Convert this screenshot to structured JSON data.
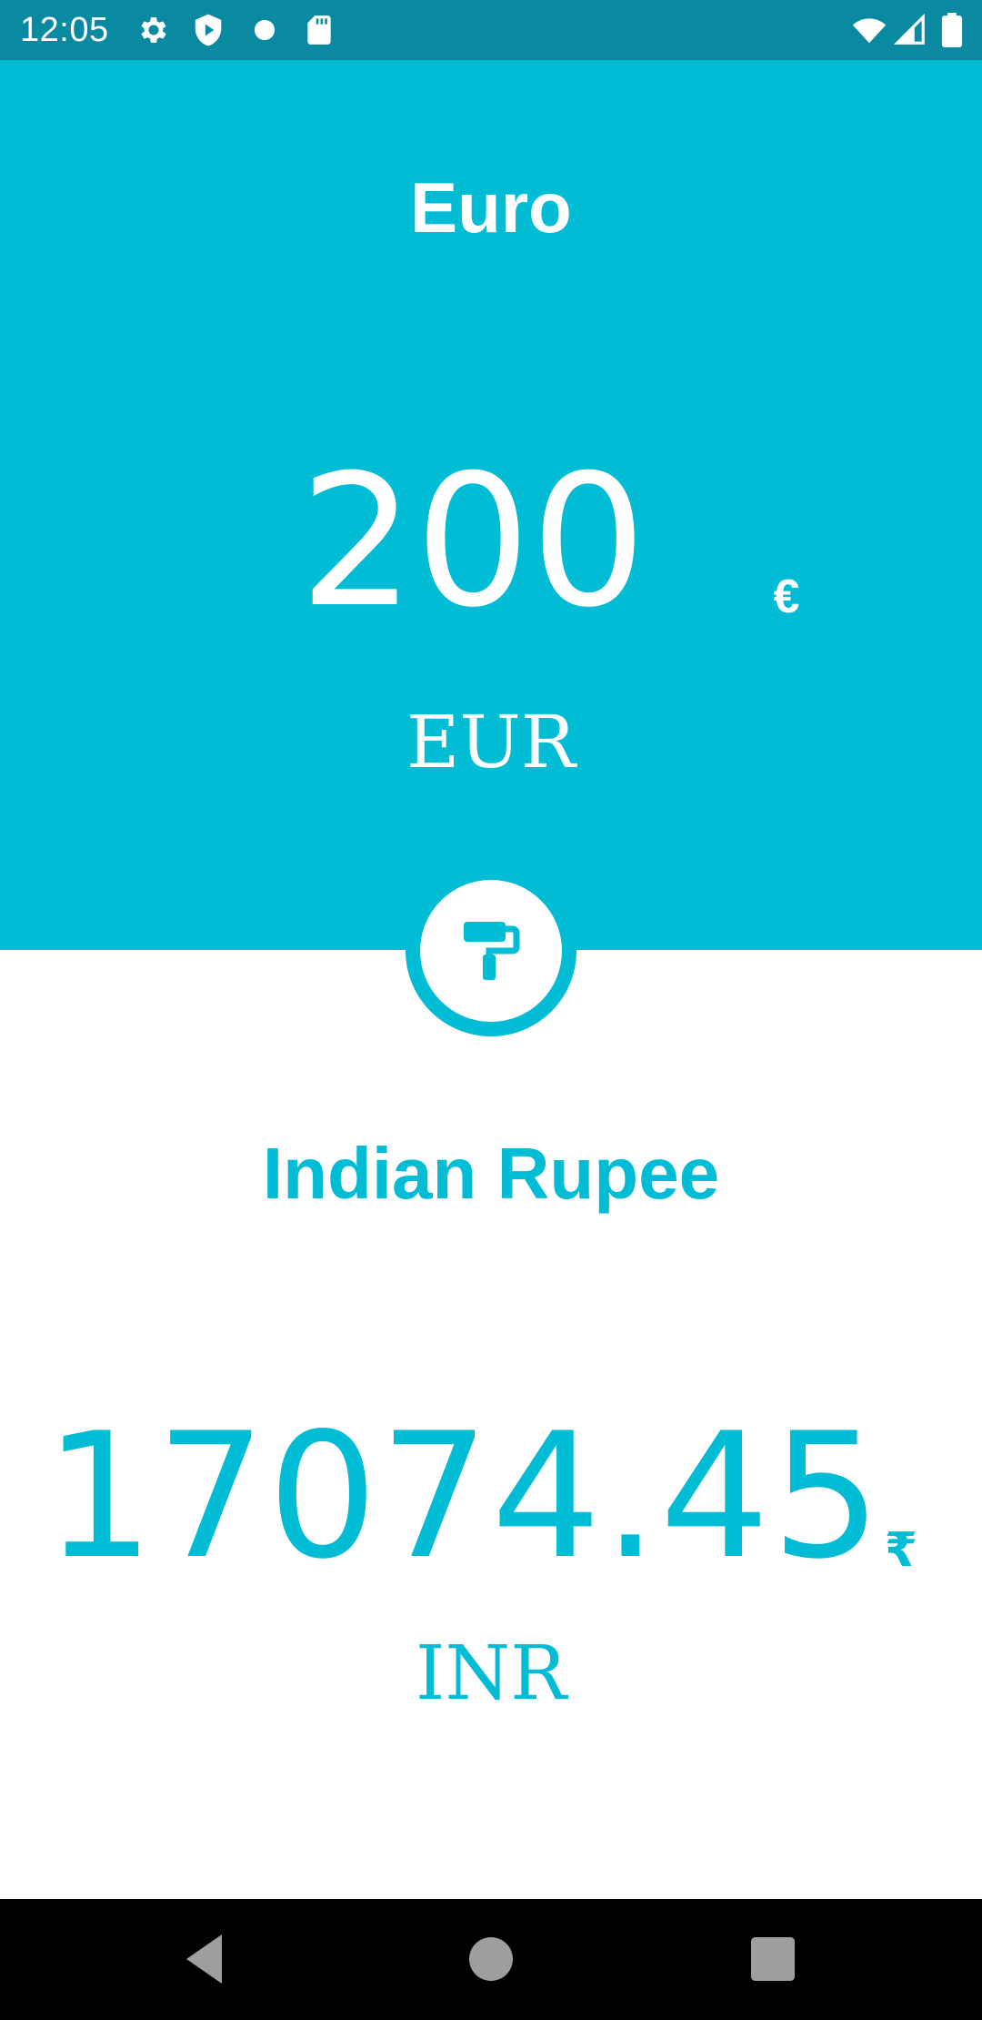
{
  "status_bar": {
    "time": "12:05",
    "left_icons": [
      "gear-icon",
      "shield-play-icon",
      "dot-icon",
      "sd-card-icon"
    ],
    "right_icons": [
      "wifi-icon",
      "cell-signal-icon",
      "battery-icon"
    ]
  },
  "source": {
    "name": "Euro",
    "amount": "200",
    "symbol": "€",
    "code": "EUR"
  },
  "swap_button": {
    "icon": "paint-roller-icon"
  },
  "target": {
    "name": "Indian Rupee",
    "amount": "17074.45",
    "symbol": "₹",
    "code": "INR"
  },
  "nav_bar": {
    "buttons": [
      "back-icon",
      "home-icon",
      "recents-icon"
    ]
  },
  "colors": {
    "accent": "#00bcd4",
    "status_bar": "#0a8aa1",
    "background": "#ffffff",
    "nav_bar": "#000000"
  }
}
